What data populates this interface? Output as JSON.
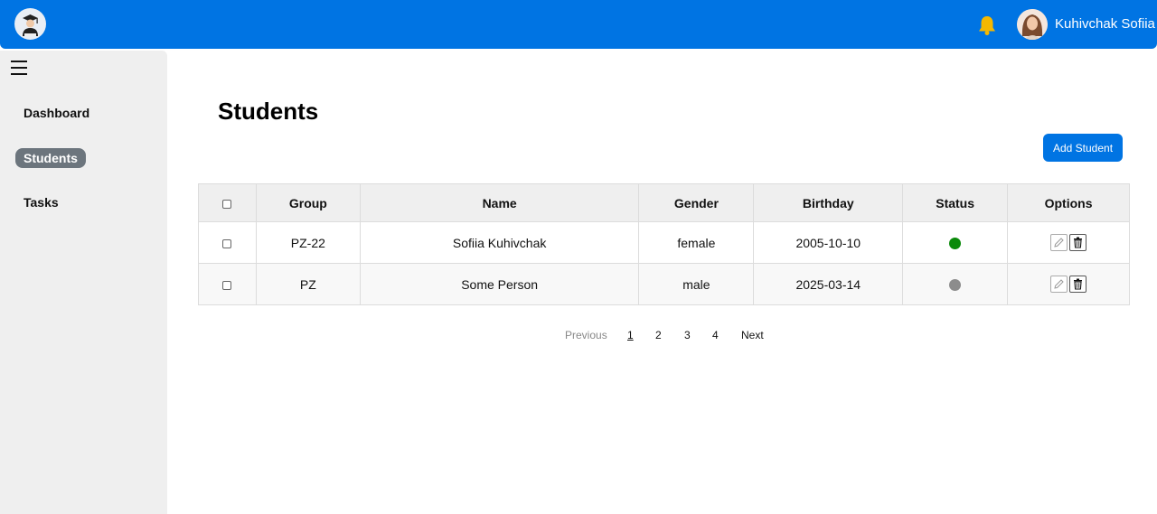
{
  "header": {
    "user_name": "Kuhivchak Sofiia"
  },
  "sidebar": {
    "items": [
      {
        "label": "Dashboard",
        "active": false
      },
      {
        "label": "Students",
        "active": true
      },
      {
        "label": "Tasks",
        "active": false
      }
    ]
  },
  "main": {
    "title": "Students",
    "add_button_label": "Add Student",
    "table": {
      "columns": [
        "Group",
        "Name",
        "Gender",
        "Birthday",
        "Status",
        "Options"
      ],
      "rows": [
        {
          "group": "PZ-22",
          "name": "Sofiia Kuhivchak",
          "gender": "female",
          "birthday": "2005-10-10",
          "status_color": "#0a8a0a"
        },
        {
          "group": "PZ",
          "name": "Some Person",
          "gender": "male",
          "birthday": "2025-03-14",
          "status_color": "#8c8c8c"
        }
      ]
    },
    "pagination": {
      "previous": "Previous",
      "pages": [
        "1",
        "2",
        "3",
        "4"
      ],
      "current": "1",
      "next": "Next"
    }
  },
  "colors": {
    "accent": "#0074e3",
    "sidebar_bg": "#efefef",
    "active_nav_bg": "#6c757d",
    "bell": "#f5b800",
    "online": "#0a8a0a",
    "offline": "#8c8c8c"
  },
  "icons": [
    "graduate-logo-icon",
    "bell-icon",
    "user-avatar",
    "hamburger-menu-icon",
    "edit-icon",
    "trash-icon"
  ]
}
